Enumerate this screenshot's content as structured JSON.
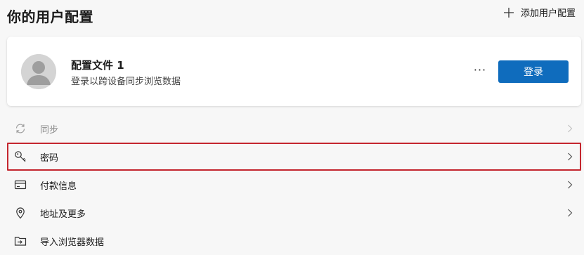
{
  "header": {
    "title": "你的用户配置",
    "add_profile_label": "添加用户配置"
  },
  "profile": {
    "name": "配置文件 1",
    "subtitle": "登录以跨设备同步浏览数据",
    "more_label": "···",
    "sign_in_label": "登录"
  },
  "menu": {
    "items": [
      {
        "label": "同步",
        "icon": "sync-icon",
        "disabled": true
      },
      {
        "label": "密码",
        "icon": "key-icon",
        "highlighted": true
      },
      {
        "label": "付款信息",
        "icon": "credit-card-icon"
      },
      {
        "label": "地址及更多",
        "icon": "location-pin-icon"
      },
      {
        "label": "导入浏览器数据",
        "icon": "import-folder-icon"
      }
    ]
  },
  "colors": {
    "accent": "#0f6cbd",
    "highlight_border": "#c4262e",
    "background": "#f7f7f7"
  }
}
